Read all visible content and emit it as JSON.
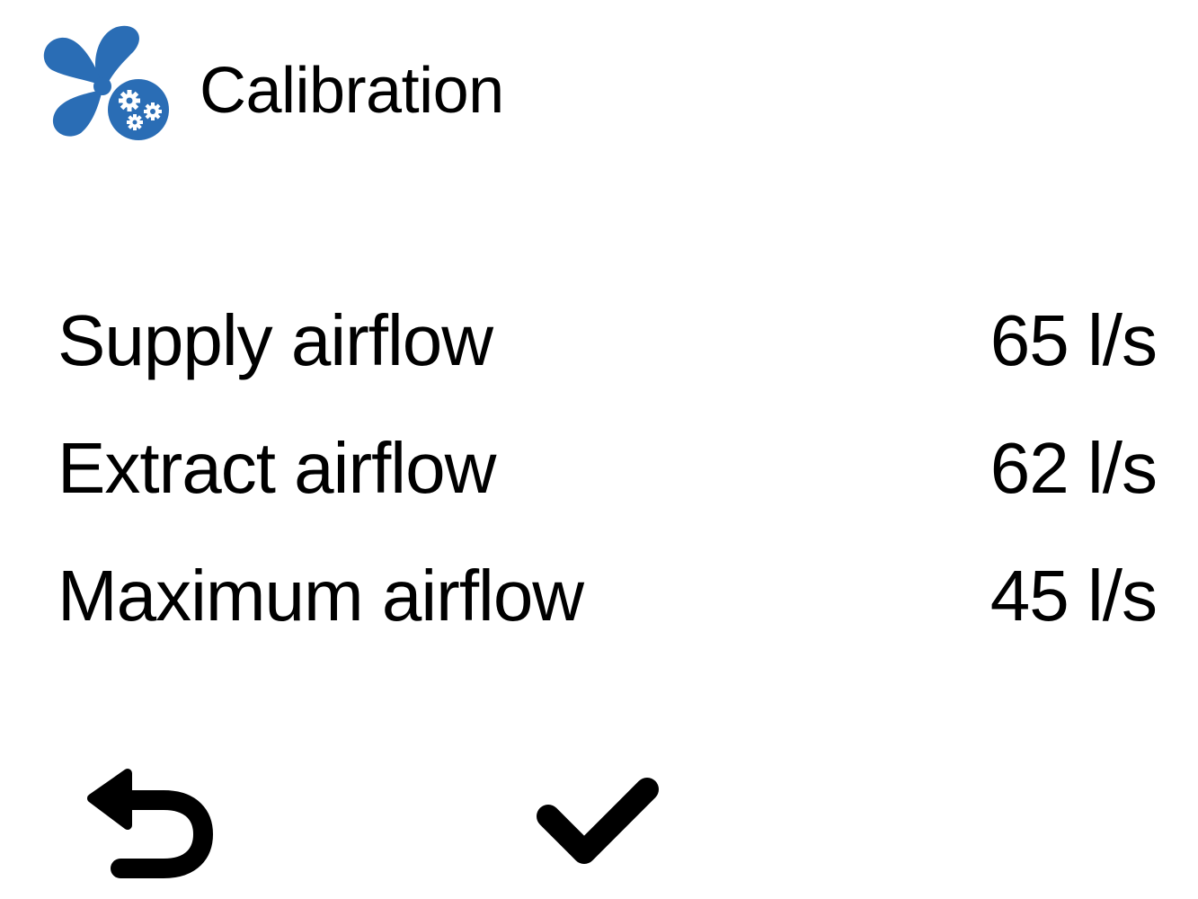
{
  "header": {
    "title": "Calibration",
    "icon": "fan-gears-icon",
    "accent_color": "#2a6db5"
  },
  "airflow_rows": [
    {
      "label": "Supply airflow",
      "value": "65 l/s"
    },
    {
      "label": "Extract airflow",
      "value": "62 l/s"
    },
    {
      "label": "Maximum airflow",
      "value": "45 l/s"
    }
  ],
  "footer": {
    "back_icon": "back-arrow-icon",
    "confirm_icon": "checkmark-icon"
  }
}
